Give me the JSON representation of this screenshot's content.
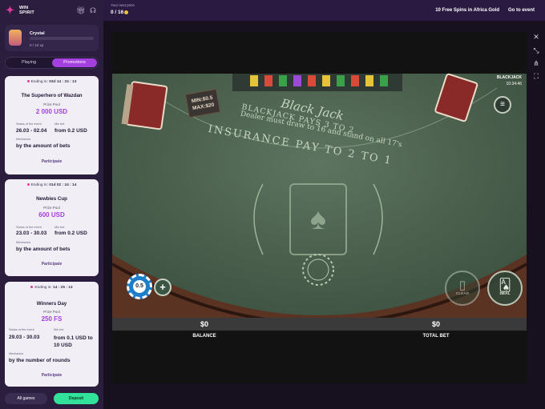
{
  "brand": {
    "logo_text": "WIN\nSPIRIT",
    "accent": "#a43fe0",
    "pink": "#e0389a",
    "green": "#30e29a"
  },
  "header": {
    "icons": [
      "gift-icon",
      "headset-icon"
    ],
    "next_prize_label": "Your next prize",
    "next_prize_value": "0 / 16",
    "promo_text": "10 Free Spins in Africa Gold",
    "goto_event": "Go to event"
  },
  "level": {
    "name": "Crystal",
    "xp": "0 / 10 xp",
    "progress": 0
  },
  "tabs": [
    {
      "label": "Playing",
      "active": false
    },
    {
      "label": "Promotions",
      "active": true
    }
  ],
  "promotions": [
    {
      "ending_label": "Ending in:",
      "ending_time": "03d 14 : 24 : 13",
      "title": "The Superhero of Wazdan",
      "pool_label": "Prize Pool",
      "pool": "2 000 USD",
      "status_label": "Status of the event",
      "status": "26.03 - 02.04",
      "minbet_label": "Min bet",
      "minbet": "from 0.2 USD",
      "mechanics_label": "Mechanics",
      "mechanics": "by the amount of bets",
      "button": "Participate"
    },
    {
      "ending_label": "Ending in:",
      "ending_time": "01d 02 : 24 : 14",
      "title": "Newbies Cup",
      "pool_label": "Prize Pool",
      "pool": "600 USD",
      "status_label": "Status of the event",
      "status": "23.03 - 30.03",
      "minbet_label": "Min bet",
      "minbet": "from 0.2 USD",
      "mechanics_label": "Mechanics",
      "mechanics": "by the amount of bets",
      "button": "Participate"
    },
    {
      "ending_label": "Ending in:",
      "ending_time": "14 : 25 : 13",
      "title": "Winners Day",
      "pool_label": "Prize Pool",
      "pool": "250 FS",
      "status_label": "Status of the event",
      "status": "29.03 - 30.03",
      "minbet_label": "Min bet",
      "minbet": "from 0.1 USD to 10 USD",
      "mechanics_label": "Mechanics",
      "mechanics": "by the number of rounds",
      "button": "Participate"
    }
  ],
  "footer": {
    "all_games": "All games",
    "deposit": "Deposit"
  },
  "frame_controls": [
    "close-icon",
    "shrink-icon",
    "share-icon",
    "fullscreen-icon"
  ],
  "game": {
    "name": "BLACKJACK",
    "time": "10:34:46",
    "table_title": "Black Jack",
    "table_line1": "BLACKJACK PAYS 3 TO 2",
    "table_line2": "Dealer must draw to 16 and stand on all 17's",
    "insurance": "INSURANCE PAY TO 2 TO 1",
    "limits_min": "MIN:$0.5",
    "limits_max": "MAX:$20",
    "chip_value": "0.5",
    "clear_label": "CLEAR",
    "deal_label": "DEAL",
    "balance_value": "$0",
    "balance_label": "BALANCE",
    "bet_value": "$0",
    "bet_label": "TOTAL BET"
  }
}
